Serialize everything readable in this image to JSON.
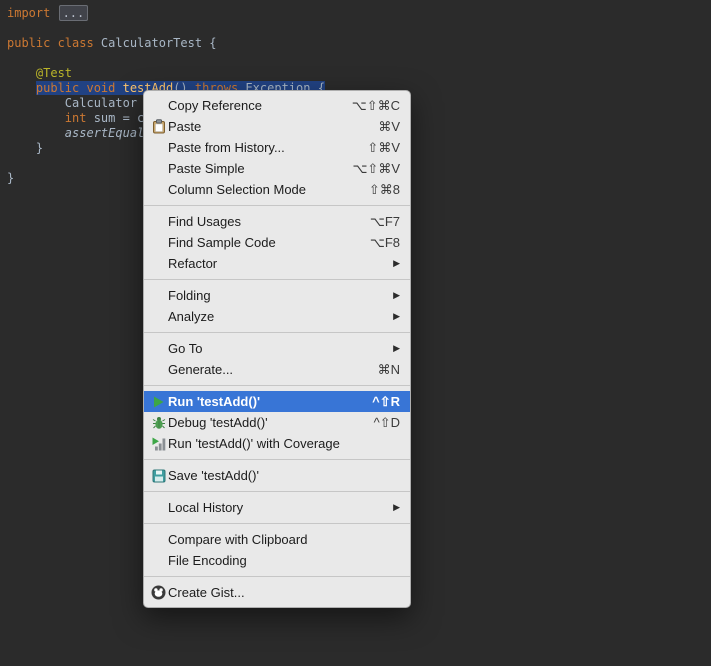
{
  "colors": {
    "editor_bg": "#2b2b2b",
    "selection_bg": "#214283",
    "menu_bg": "#e9e9e9",
    "menu_highlight": "#3875d6",
    "keyword": "#cc7832",
    "annotation": "#bbb529",
    "plain_text": "#a9b7c6",
    "method_name": "#ffc66d"
  },
  "editor": {
    "lines": [
      {
        "indent": 0,
        "segments": [
          {
            "text": "import ",
            "style": "keyword"
          },
          {
            "text": "...",
            "style": "folded"
          }
        ]
      },
      {
        "indent": 0,
        "segments": []
      },
      {
        "indent": 0,
        "segments": [
          {
            "text": "public class ",
            "style": "keyword"
          },
          {
            "text": "CalculatorTest {",
            "style": "plain"
          }
        ]
      },
      {
        "indent": 0,
        "segments": []
      },
      {
        "indent": 4,
        "segments": [
          {
            "text": "@Test",
            "style": "annotation"
          }
        ]
      },
      {
        "indent": 4,
        "selected": true,
        "segments": [
          {
            "text": "public void ",
            "style": "keyword"
          },
          {
            "text": "testAdd",
            "style": "method"
          },
          {
            "text": "() ",
            "style": "plain"
          },
          {
            "text": "throws",
            "style": "keyword"
          },
          {
            "text": " Exception {",
            "style": "plain"
          }
        ]
      },
      {
        "indent": 8,
        "segments": [
          {
            "text": "Calculator",
            "style": "plain"
          }
        ]
      },
      {
        "indent": 8,
        "segments": [
          {
            "text": "int",
            "style": "keyword"
          },
          {
            "text": " sum = c",
            "style": "plain"
          }
        ]
      },
      {
        "indent": 8,
        "segments": [
          {
            "text": "assertEqual",
            "style": "italic"
          }
        ]
      },
      {
        "indent": 4,
        "segments": [
          {
            "text": "}",
            "style": "plain"
          }
        ]
      },
      {
        "indent": 0,
        "segments": []
      },
      {
        "indent": 0,
        "segments": [
          {
            "text": "}",
            "style": "plain"
          }
        ]
      }
    ]
  },
  "menu": {
    "items": [
      {
        "type": "item",
        "label": "Copy Reference",
        "shortcut": "⌥⇧⌘C"
      },
      {
        "type": "item",
        "label": "Paste",
        "shortcut": "⌘V",
        "icon": "paste"
      },
      {
        "type": "item",
        "label": "Paste from History...",
        "shortcut": "⇧⌘V"
      },
      {
        "type": "item",
        "label": "Paste Simple",
        "shortcut": "⌥⇧⌘V"
      },
      {
        "type": "item",
        "label": "Column Selection Mode",
        "shortcut": "⇧⌘8"
      },
      {
        "type": "separator"
      },
      {
        "type": "item",
        "label": "Find Usages",
        "shortcut": "⌥F7"
      },
      {
        "type": "item",
        "label": "Find Sample Code",
        "shortcut": "⌥F8"
      },
      {
        "type": "item",
        "label": "Refactor",
        "submenu": true
      },
      {
        "type": "separator"
      },
      {
        "type": "item",
        "label": "Folding",
        "submenu": true
      },
      {
        "type": "item",
        "label": "Analyze",
        "submenu": true
      },
      {
        "type": "separator"
      },
      {
        "type": "item",
        "label": "Go To",
        "submenu": true
      },
      {
        "type": "item",
        "label": "Generate...",
        "shortcut": "⌘N"
      },
      {
        "type": "separator"
      },
      {
        "type": "item",
        "label": "Run 'testAdd()'",
        "shortcut": "^⇧R",
        "icon": "run",
        "highlighted": true
      },
      {
        "type": "item",
        "label": "Debug 'testAdd()'",
        "shortcut": "^⇧D",
        "icon": "debug"
      },
      {
        "type": "item",
        "label": "Run 'testAdd()' with Coverage",
        "icon": "coverage"
      },
      {
        "type": "separator"
      },
      {
        "type": "item",
        "label": "Save 'testAdd()'",
        "icon": "save"
      },
      {
        "type": "separator"
      },
      {
        "type": "item",
        "label": "Local History",
        "submenu": true
      },
      {
        "type": "separator"
      },
      {
        "type": "item",
        "label": "Compare with Clipboard"
      },
      {
        "type": "item",
        "label": "File Encoding"
      },
      {
        "type": "separator"
      },
      {
        "type": "item",
        "label": "Create Gist...",
        "icon": "gist"
      }
    ]
  }
}
